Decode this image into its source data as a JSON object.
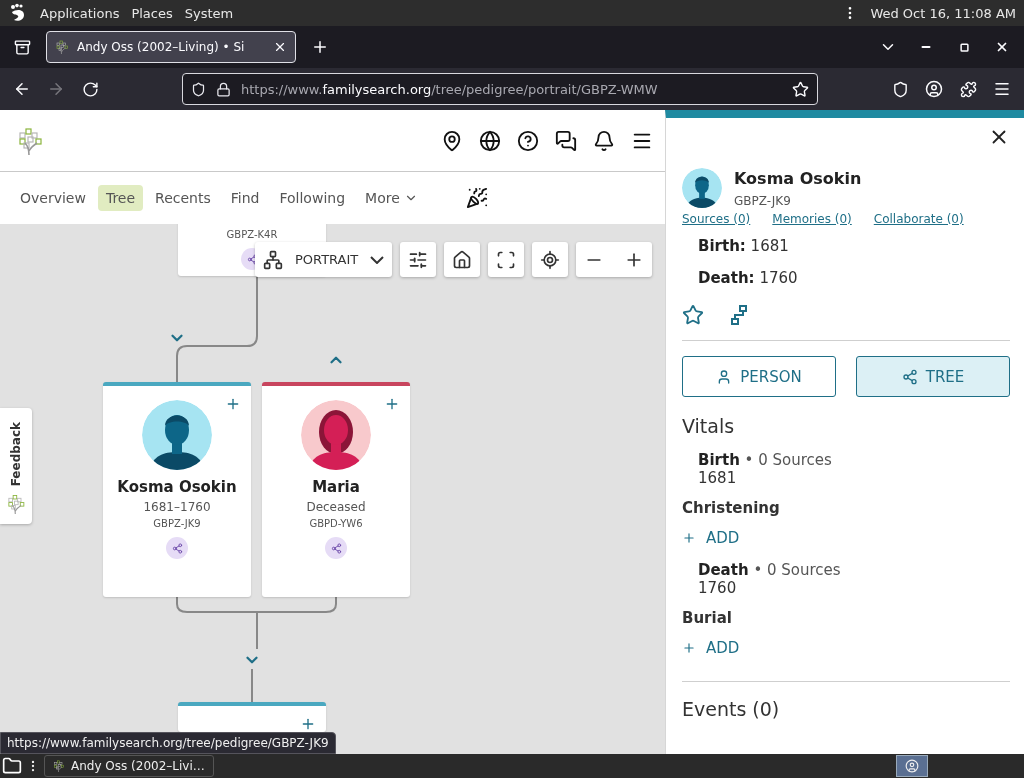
{
  "desktop_panel": {
    "menus": [
      "Applications",
      "Places",
      "System"
    ],
    "clock": "Wed Oct 16, 11:08 AM"
  },
  "browser": {
    "tabs": [
      {
        "title": "Andy Oss (2002–Living) • Si",
        "selected": true
      }
    ],
    "url": {
      "prefix": "https://www.",
      "domain": "familysearch.org",
      "path": "/tree/pedigree/portrait/GBPZ-WMW"
    },
    "status_link": "https://www.familysearch.org/tree/pedigree/GBPZ-JK9"
  },
  "site_nav": [
    {
      "label": "Overview",
      "selected": false
    },
    {
      "label": "Tree",
      "selected": true
    },
    {
      "label": "Recents",
      "selected": false
    },
    {
      "label": "Find",
      "selected": false
    },
    {
      "label": "Following",
      "selected": false
    },
    {
      "label": "More",
      "selected": false
    }
  ],
  "tree": {
    "view_label": "PORTRAIT",
    "feedback": "Feedback",
    "cards": [
      {
        "kind": "partial",
        "code": "GBPZ-K4R"
      },
      {
        "kind": "male",
        "name": "Kosma Osokin",
        "lifespan": "1681–1760",
        "code": "GBPZ-JK9"
      },
      {
        "kind": "female",
        "name": "Maria",
        "lifespan": "Deceased",
        "code": "GBPD-YW6"
      },
      {
        "kind": "male"
      }
    ]
  },
  "person_panel": {
    "name": "Kosma Osokin",
    "code": "GBPZ-JK9",
    "links": [
      "Sources (0)",
      "Memories (0)",
      "Collaborate (0)"
    ],
    "facts": [
      {
        "label": "Birth:",
        "value": "1681"
      },
      {
        "label": "Death:",
        "value": "1760"
      }
    ],
    "buttons": [
      {
        "kind": "person",
        "label": "PERSON",
        "selected": false
      },
      {
        "kind": "tree",
        "label": "TREE",
        "selected": true
      }
    ],
    "vitals_title": "Vitals",
    "vitals": [
      {
        "kind": "fact",
        "label": "Birth",
        "sources": "• 0 Sources",
        "value": "1681"
      },
      {
        "kind": "empty",
        "label": "Christening",
        "action": "ADD"
      },
      {
        "kind": "fact",
        "label": "Death",
        "sources": "• 0 Sources",
        "value": "1760"
      },
      {
        "kind": "empty",
        "label": "Burial",
        "action": "ADD"
      }
    ],
    "events_title": "Events (0)"
  },
  "taskbar": {
    "tasks": [
      {
        "title": "Andy Oss (2002–Livi…",
        "selected": false
      }
    ]
  }
}
